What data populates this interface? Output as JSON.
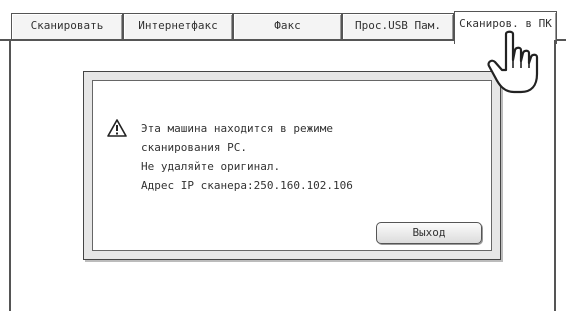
{
  "tabs": [
    {
      "label": "Сканировать"
    },
    {
      "label": "Интернетфакс"
    },
    {
      "label": "Факс"
    },
    {
      "label": "Прос.USB Пам."
    },
    {
      "label": "Сканиров. в ПК"
    }
  ],
  "dialog": {
    "icon": "warning-icon",
    "lines": [
      "Эта машина находится в режиме",
      "сканирования PC.",
      "Не удаляйте оригинал.",
      "Адрес IP сканера:250.160.102.106"
    ],
    "exit_label": "Выход"
  },
  "pointer": {
    "icon": "hand-pointer-icon"
  }
}
